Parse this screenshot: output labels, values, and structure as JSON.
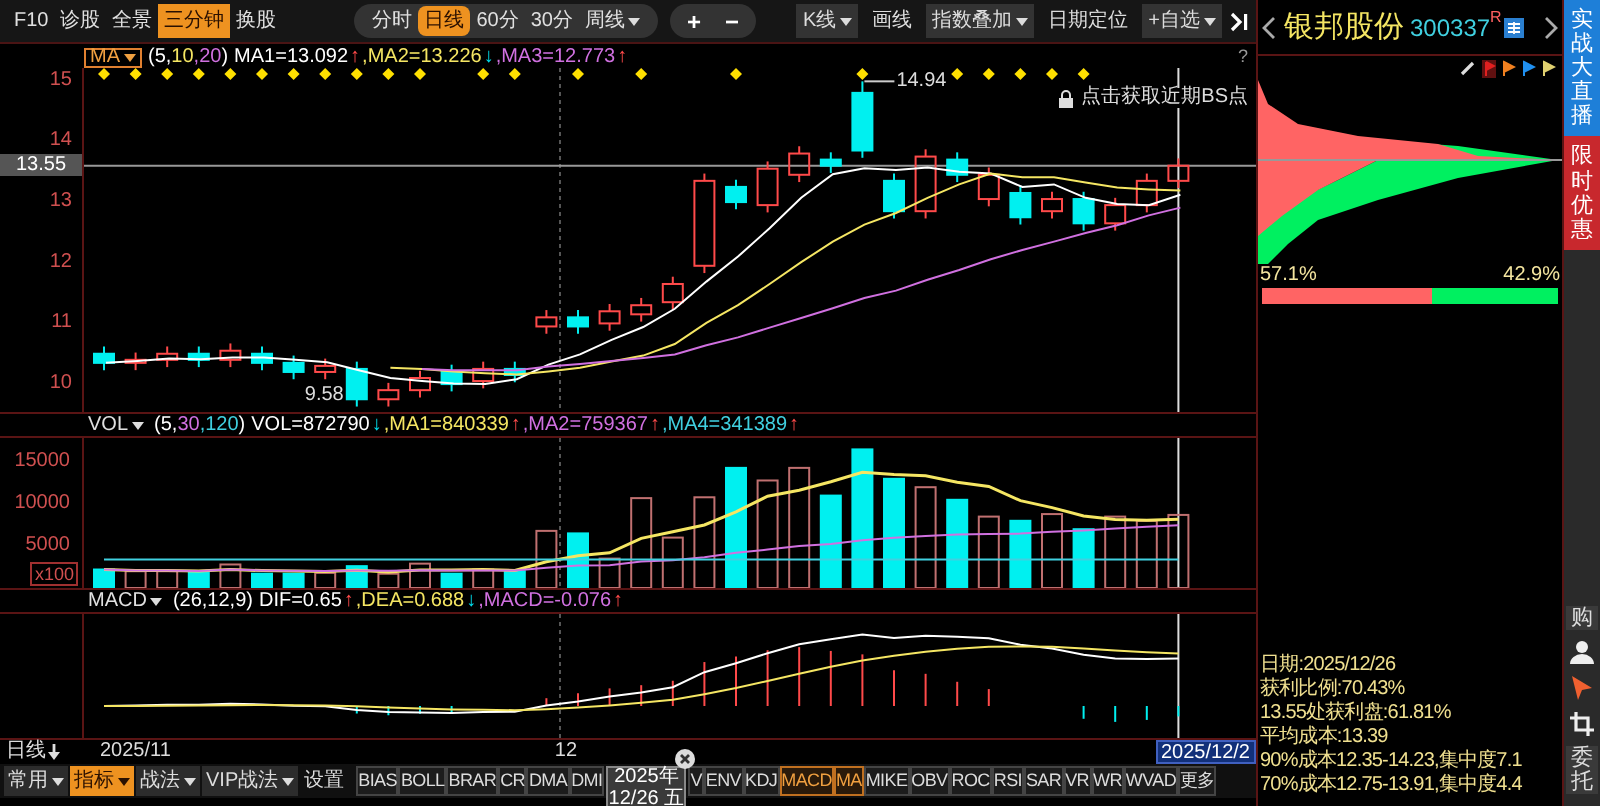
{
  "toolbar": {
    "left": [
      {
        "label": "F10",
        "selected": false
      },
      {
        "label": "诊股",
        "selected": false
      },
      {
        "label": "全景",
        "selected": false
      },
      {
        "label": "三分钟",
        "selected": true
      },
      {
        "label": "换股",
        "selected": false
      }
    ],
    "periods": [
      {
        "label": "分时",
        "selected": false,
        "dropdown": false
      },
      {
        "label": "日线",
        "selected": true,
        "dropdown": false
      },
      {
        "label": "60分",
        "selected": false,
        "dropdown": false
      },
      {
        "label": "30分",
        "selected": false,
        "dropdown": false
      },
      {
        "label": "周线",
        "selected": false,
        "dropdown": true
      }
    ],
    "zoom": [
      "+",
      "−"
    ],
    "right": [
      {
        "label": "K线",
        "dropdown": true
      },
      {
        "label": "画线",
        "dropdown": false
      },
      {
        "label": "指数叠加",
        "dropdown": true
      },
      {
        "label": "日期定位",
        "dropdown": false
      },
      {
        "label": "+自选",
        "dropdown": true
      }
    ],
    "help": "?"
  },
  "ma_header": {
    "name": "MA",
    "boxed": true,
    "params": [
      {
        "text": "(5,",
        "kind": "main"
      },
      {
        "text": "10",
        "kind": "line1"
      },
      {
        "text": ",20",
        "kind": "line2"
      },
      {
        "text": ")",
        "kind": "main"
      }
    ],
    "readings": [
      {
        "text": "MA1=13.092",
        "kind": "main",
        "arrow": {
          "text": "↑",
          "kind": "up"
        }
      },
      {
        "text": ",MA2=13.226",
        "kind": "line1",
        "arrow": {
          "text": "↓",
          "kind": "down"
        }
      },
      {
        "text": ",MA3=12.773",
        "kind": "line2",
        "arrow": {
          "text": "↑",
          "kind": "up"
        }
      }
    ]
  },
  "price_chart": {
    "current_price": "13.55",
    "high_label": "14.94",
    "low_label": "9.58",
    "bs_hint": "点击获取近期BS点",
    "chart_data": {
      "type": "line",
      "ylim": [
        9.49,
        15.16
      ],
      "yticks": [
        15,
        14,
        13,
        12,
        11,
        10
      ],
      "series": [
        {
          "color": "#ffffff",
          "values": [
            10.3,
            10.33,
            10.37,
            10.36,
            10.39,
            10.39,
            10.35,
            10.31,
            10.18,
            10.05,
            10.0,
            9.96,
            9.95,
            10.03,
            10.27,
            10.44,
            10.68,
            10.89,
            11.19,
            11.64,
            12.05,
            12.52,
            13.02,
            13.41,
            13.51,
            13.48,
            13.52,
            13.45,
            13.42,
            13.2,
            13.24,
            13.02,
            12.92,
            12.9,
            13.07
          ]
        },
        {
          "color": "#f5e663",
          "values": [
            null,
            null,
            null,
            null,
            null,
            null,
            null,
            null,
            null,
            10.22,
            10.2,
            10.16,
            10.13,
            10.11,
            10.16,
            10.22,
            10.32,
            10.42,
            10.61,
            10.96,
            11.25,
            11.6,
            11.96,
            12.3,
            12.58,
            12.77,
            13.02,
            13.24,
            13.42,
            13.36,
            13.36,
            13.27,
            13.19,
            13.16,
            13.14
          ]
        },
        {
          "color": "#d070e0",
          "values": [
            null,
            null,
            null,
            null,
            null,
            null,
            null,
            null,
            null,
            null,
            10.2,
            10.18,
            10.18,
            10.18,
            10.24,
            10.28,
            10.33,
            10.38,
            10.44,
            10.59,
            10.72,
            10.88,
            11.04,
            11.2,
            11.37,
            11.49,
            11.67,
            11.83,
            12.01,
            12.16,
            12.3,
            12.44,
            12.57,
            12.73,
            12.86
          ]
        }
      ]
    }
  },
  "volume": {
    "header": {
      "name": "VOL",
      "boxed": false,
      "params": [
        {
          "text": "(5,",
          "kind": "main"
        },
        {
          "text": "30",
          "kind": "line2"
        },
        {
          "text": ",120",
          "kind": "line3"
        },
        {
          "text": ")",
          "kind": "main"
        }
      ],
      "readings": [
        {
          "text": "VOL=872790",
          "kind": "main",
          "arrow": {
            "text": "↓",
            "kind": "down"
          }
        },
        {
          "text": ",MA1=840339",
          "kind": "line1",
          "arrow": {
            "text": "↑",
            "kind": "up"
          }
        },
        {
          "text": ",MA2=759367",
          "kind": "line2",
          "arrow": {
            "text": "↑",
            "kind": "up"
          }
        },
        {
          "text": ",MA4=341389",
          "kind": "line3",
          "arrow": {
            "text": "↑",
            "kind": "up"
          }
        }
      ]
    },
    "axis": [
      "15000",
      "10000",
      "5000"
    ],
    "unit": "x100"
  },
  "macd": {
    "header": {
      "name": "MACD",
      "boxed": false,
      "params": [
        {
          "text": "(26,12,9)",
          "kind": "main"
        }
      ],
      "readings": [
        {
          "text": "DIF=0.65",
          "kind": "main",
          "arrow": {
            "text": "↑",
            "kind": "up"
          }
        },
        {
          "text": ",DEA=0.688",
          "kind": "line1",
          "arrow": {
            "text": "↓",
            "kind": "down"
          }
        },
        {
          "text": ",MACD=-0.076",
          "kind": "line2",
          "arrow": {
            "text": "↑",
            "kind": "up"
          }
        }
      ]
    }
  },
  "date_axis": {
    "period": "日线",
    "labels": [
      "2025/11",
      "12"
    ],
    "cursor_date": "2025/12/2"
  },
  "bottom_toolbar": {
    "menus": [
      {
        "label": "常用",
        "selected": false,
        "dropdown": true
      },
      {
        "label": "指标",
        "selected": true,
        "dropdown": true
      },
      {
        "label": "战法",
        "selected": false,
        "dropdown": true
      },
      {
        "label": "VIP战法",
        "selected": false,
        "dropdown": true
      },
      {
        "label": "设置",
        "selected": false,
        "dropdown": false
      }
    ],
    "indicators": [
      {
        "label": "BIAS",
        "selected": false
      },
      {
        "label": "BOLL",
        "selected": false
      },
      {
        "label": "BRAR",
        "selected": false
      },
      {
        "label": "CR",
        "selected": false
      },
      {
        "label": "DMA",
        "selected": false
      },
      {
        "label": "DMI",
        "selected": false
      },
      {
        "label": "V",
        "selected": false
      },
      {
        "label": "ENV",
        "selected": false
      },
      {
        "label": "KDJ",
        "selected": false
      },
      {
        "label": "MACD",
        "selected": true
      },
      {
        "label": "MA",
        "selected": true
      },
      {
        "label": "MIKE",
        "selected": false
      },
      {
        "label": "OBV",
        "selected": false
      },
      {
        "label": "ROC",
        "selected": false
      },
      {
        "label": "RSI",
        "selected": false
      },
      {
        "label": "SAR",
        "selected": false
      },
      {
        "label": "VR",
        "selected": false
      },
      {
        "label": "WR",
        "selected": false
      },
      {
        "label": "WVAD",
        "selected": false
      },
      {
        "label": "更多",
        "selected": false
      }
    ]
  },
  "tooltip": {
    "year": "2025年",
    "date": "12/26 五"
  },
  "stock": {
    "name": "银邦股份",
    "code": "300337",
    "mark": "R"
  },
  "chips": {
    "profit_pct": "57.1%",
    "loss_pct": "42.9%",
    "level": 0.571,
    "stats": [
      "日期:2025/12/26",
      "获利比例:70.43%",
      "13.55处获利盘:61.81%",
      "平均成本:13.39",
      "90%成本12.35-14.23,集中度7.1",
      "70%成本12.75-13.91,集中度4.4"
    ]
  },
  "side_tabs": [
    {
      "label": "实战大直播",
      "color": "#1e7fd8"
    },
    {
      "label": "限时优惠",
      "color": "#c8282d"
    }
  ],
  "side_tools": [
    {
      "kind": "text",
      "label": "购"
    },
    {
      "kind": "person"
    },
    {
      "kind": "cursor"
    },
    {
      "kind": "crop"
    },
    {
      "kind": "text",
      "label": "委托"
    }
  ]
}
